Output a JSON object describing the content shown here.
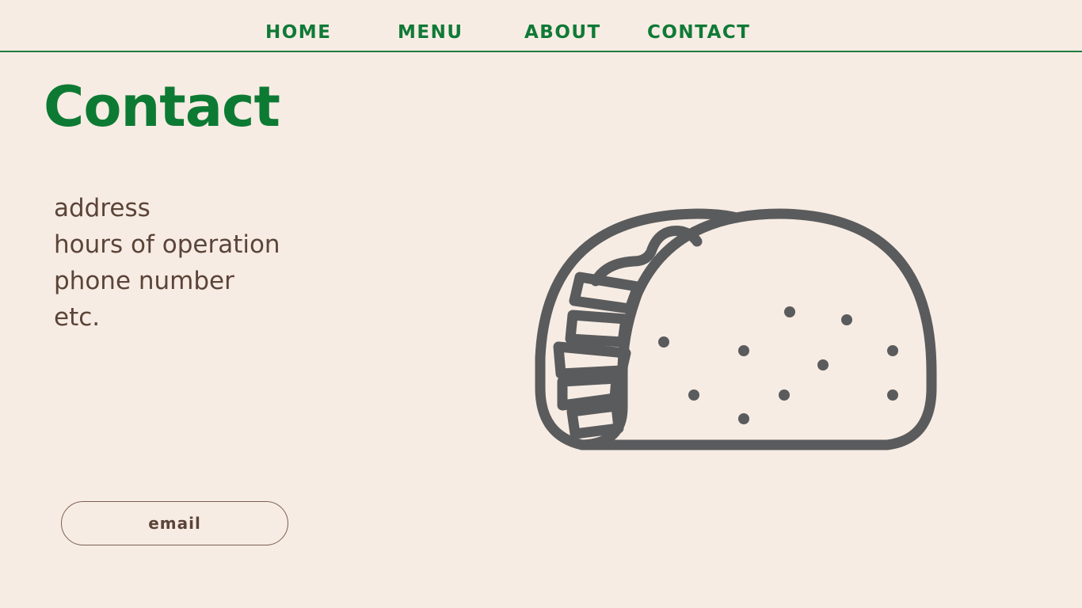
{
  "nav": {
    "items": [
      {
        "label": "HOME"
      },
      {
        "label": "MENU"
      },
      {
        "label": "ABOUT"
      },
      {
        "label": "CONTACT"
      }
    ]
  },
  "page": {
    "title": "Contact"
  },
  "info": {
    "lines": [
      "address",
      "hours of operation",
      "phone number",
      "etc."
    ]
  },
  "email_button": {
    "label": "email"
  },
  "illustration": {
    "icon": "taco-icon",
    "stroke_color": "#5a5b5d"
  },
  "colors": {
    "background": "#f7ece3",
    "brand_green": "#0d7a33",
    "text_brown": "#5b4438"
  }
}
